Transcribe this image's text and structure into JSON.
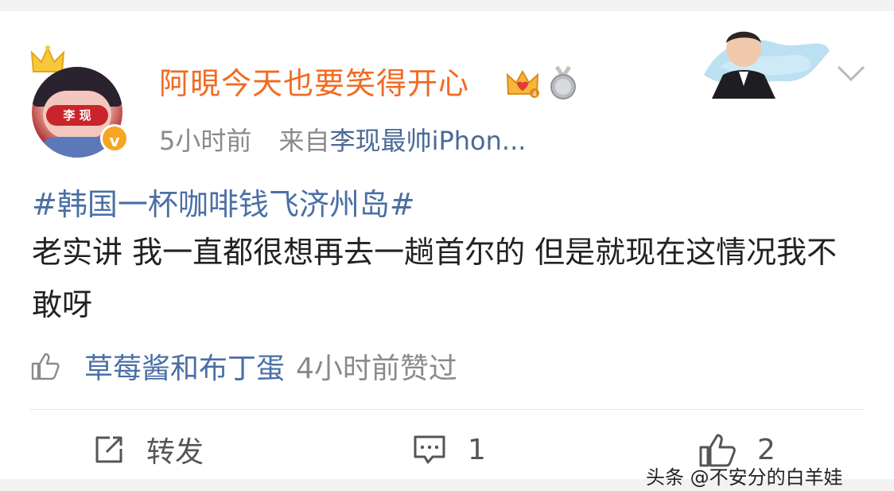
{
  "post": {
    "username": "阿晛今天也要笑得开心",
    "time": "5小时前",
    "source_prefix": "来自",
    "source_app": "李现最帅iPhon...",
    "hashtag": "#韩国一杯咖啡钱飞济州岛#",
    "text": "老实讲 我一直都很想再去一趟首尔的 但是就现在这情况我不敢呀",
    "avatar_tag": "李 现",
    "verified_icon": "v-icon"
  },
  "like_info": {
    "liker": "草莓酱和布丁蛋",
    "time_text": "4小时前赞过"
  },
  "actions": {
    "repost_label": "转发",
    "comment_count": "1",
    "like_count": "2"
  },
  "watermark": "头条 @不安分的白羊娃",
  "colors": {
    "username": "#f26a22",
    "link": "#4a6fa5",
    "meta": "#8a8a8a",
    "verified": "#f5a623"
  }
}
